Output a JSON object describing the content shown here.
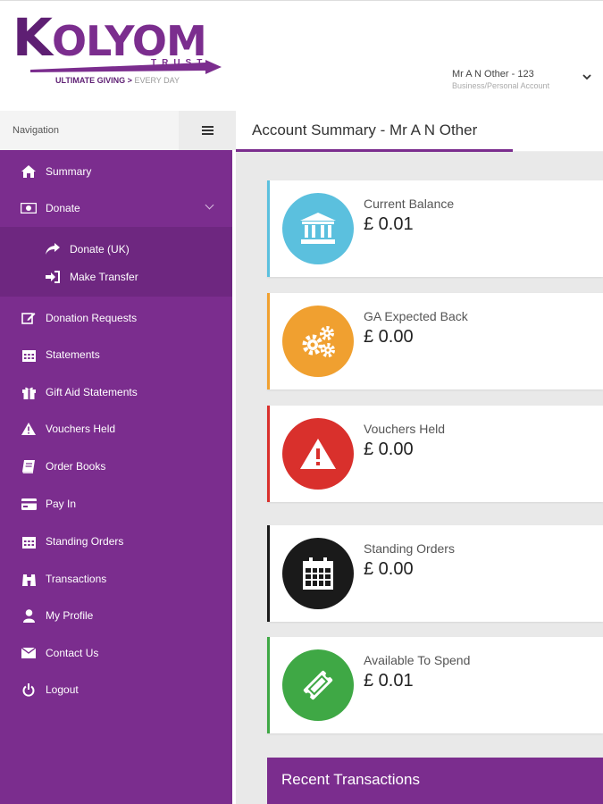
{
  "brand": {
    "first_letter": "K",
    "rest": "OLYOM",
    "trust": "TRUST",
    "tagline_main": "ULTIMATE GIVING >",
    "tagline_gray": "EVERY DAY",
    "colors": {
      "purple": "#7b2d8e",
      "dark_purple": "#5e1f73"
    }
  },
  "account": {
    "name": "Mr A N Other - 123",
    "type": "Business/Personal Account",
    "chevron_icon": "chevron-down-icon"
  },
  "nav": {
    "label": "Navigation",
    "toggle_icon": "hamburger-icon"
  },
  "page": {
    "title": "Account Summary - Mr A N Other"
  },
  "sidebar": {
    "items": [
      {
        "label": "Summary",
        "icon": "home-icon"
      },
      {
        "label": "Donate",
        "icon": "money-icon"
      },
      {
        "label": "Donation Requests",
        "icon": "edit-icon"
      },
      {
        "label": "Statements",
        "icon": "calendar-icon"
      },
      {
        "label": "Gift Aid Statements",
        "icon": "gift-icon"
      },
      {
        "label": "Vouchers Held",
        "icon": "warning-icon"
      },
      {
        "label": "Order Books",
        "icon": "book-icon"
      },
      {
        "label": "Pay In",
        "icon": "credit-card-icon"
      },
      {
        "label": "Standing Orders",
        "icon": "calendar-icon"
      },
      {
        "label": "Transactions",
        "icon": "binoculars-icon"
      },
      {
        "label": "My Profile",
        "icon": "user-icon"
      },
      {
        "label": "Contact Us",
        "icon": "envelope-icon"
      },
      {
        "label": "Logout",
        "icon": "power-icon"
      }
    ],
    "submenu": [
      {
        "label": "Donate (UK)",
        "icon": "share-icon"
      },
      {
        "label": "Make Transfer",
        "icon": "sign-in-icon"
      }
    ]
  },
  "cards": [
    {
      "label": "Current Balance",
      "value": "£ 0.01",
      "color": "#5bc0de",
      "icon": "bank-icon"
    },
    {
      "label": "GA Expected Back",
      "value": "£ 0.00",
      "color": "#f0a030",
      "icon": "cogs-icon"
    },
    {
      "label": "Vouchers Held",
      "value": "£ 0.00",
      "color": "#d9302c",
      "icon": "warning-icon"
    },
    {
      "label": "Standing Orders",
      "value": "£ 0.00",
      "color": "#1a1a1a",
      "icon": "calendar-icon"
    },
    {
      "label": "Available To Spend",
      "value": "£ 0.01",
      "color": "#3fa845",
      "icon": "ticket-icon"
    }
  ],
  "recent": {
    "title": "Recent Transactions"
  }
}
